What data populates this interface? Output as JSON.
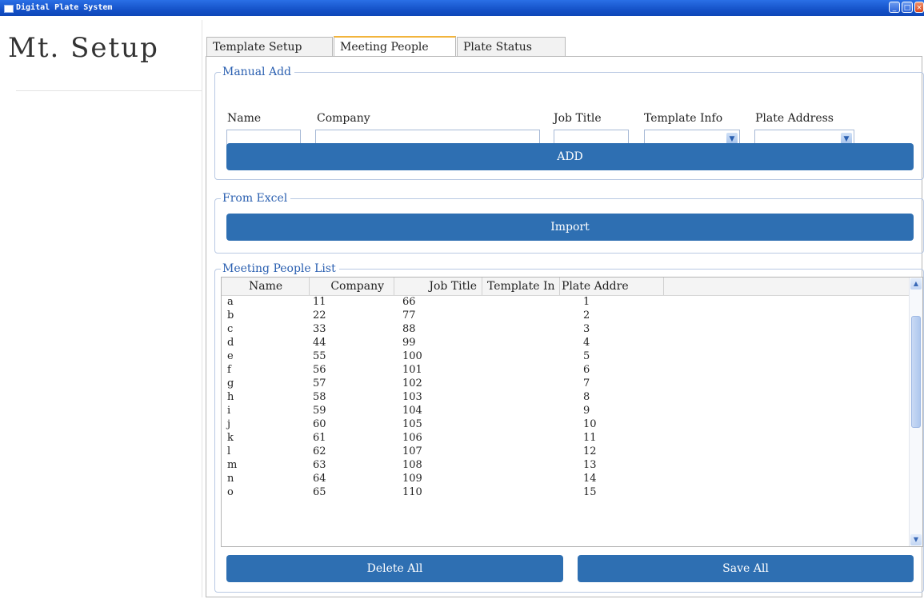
{
  "window": {
    "title": "Digital Plate System"
  },
  "left_panel": {
    "title": "Mt.  Setup"
  },
  "tabs": [
    {
      "label": "Template Setup",
      "active": false
    },
    {
      "label": "Meeting People",
      "active": true
    },
    {
      "label": "Plate Status",
      "active": false
    }
  ],
  "manual_add": {
    "legend": "Manual Add",
    "labels": {
      "name": "Name",
      "company": "Company",
      "job_title": "Job Title",
      "template_info": "Template Info",
      "plate_address": "Plate Address"
    },
    "values": {
      "name": "",
      "company": "",
      "job_title": "",
      "template_info": "",
      "plate_address": ""
    },
    "add_button": "ADD"
  },
  "from_excel": {
    "legend": "From Excel",
    "import_button": "Import"
  },
  "people_list": {
    "legend": "Meeting People List",
    "columns": [
      "Name",
      "Company",
      "Job Title",
      "Template In",
      "Plate Addre"
    ],
    "rows": [
      [
        "a",
        "11",
        "66",
        "",
        "1"
      ],
      [
        "b",
        "22",
        "77",
        "",
        "2"
      ],
      [
        "c",
        "33",
        "88",
        "",
        "3"
      ],
      [
        "d",
        "44",
        "99",
        "",
        "4"
      ],
      [
        "e",
        "55",
        "100",
        "",
        "5"
      ],
      [
        "f",
        "56",
        "101",
        "",
        "6"
      ],
      [
        "g",
        "57",
        "102",
        "",
        "7"
      ],
      [
        "h",
        "58",
        "103",
        "",
        "8"
      ],
      [
        "i",
        "59",
        "104",
        "",
        "9"
      ],
      [
        "j",
        "60",
        "105",
        "",
        "10"
      ],
      [
        "k",
        "61",
        "106",
        "",
        "11"
      ],
      [
        "l",
        "62",
        "107",
        "",
        "12"
      ],
      [
        "m",
        "63",
        "108",
        "",
        "13"
      ],
      [
        "n",
        "64",
        "109",
        "",
        "14"
      ],
      [
        "o",
        "65",
        "110",
        "",
        "15"
      ]
    ]
  },
  "buttons": {
    "delete_all": "Delete All",
    "save_all": "Save All"
  },
  "colors": {
    "accent": "#2e6fb2",
    "legend_text": "#2a5fb0",
    "titlebar": "#1552c8",
    "active_tab_indicator": "#f2b43c"
  }
}
